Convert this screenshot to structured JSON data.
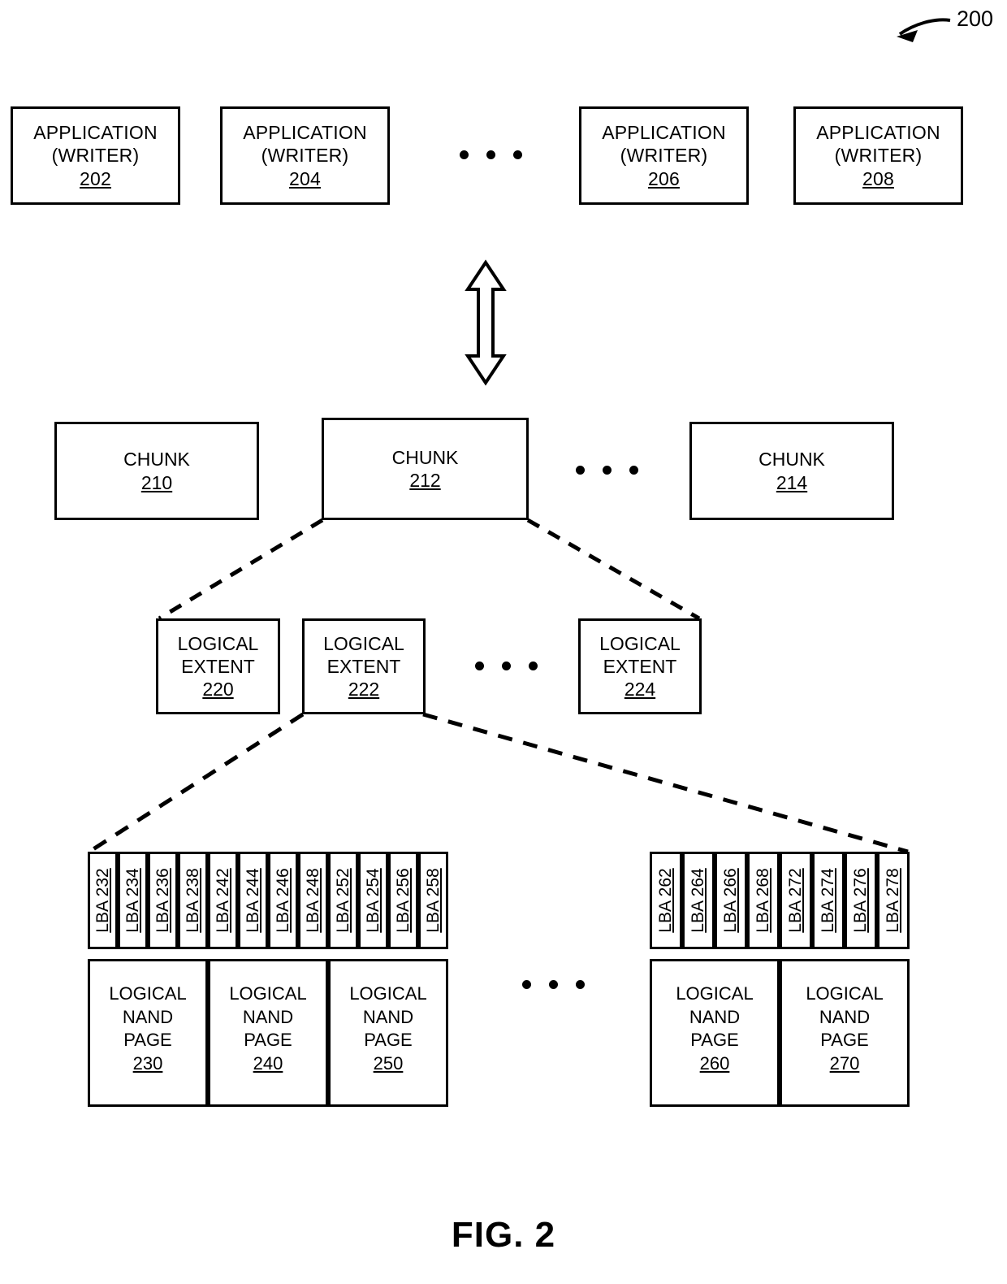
{
  "figure": {
    "caption": "FIG. 2",
    "system_ref": "200"
  },
  "applications": {
    "title": "APPLICATION",
    "subtitle": "(WRITER)",
    "items": [
      {
        "title": "APPLICATION",
        "subtitle": "(WRITER)",
        "ref": "202"
      },
      {
        "title": "APPLICATION",
        "subtitle": "(WRITER)",
        "ref": "204"
      },
      {
        "title": "APPLICATION",
        "subtitle": "(WRITER)",
        "ref": "206"
      },
      {
        "title": "APPLICATION",
        "subtitle": "(WRITER)",
        "ref": "208"
      }
    ]
  },
  "chunks": {
    "label": "CHUNK",
    "items": [
      {
        "label": "CHUNK",
        "ref": "210"
      },
      {
        "label": "CHUNK",
        "ref": "212"
      },
      {
        "label": "CHUNK",
        "ref": "214"
      }
    ]
  },
  "logical_extents": {
    "line1": "LOGICAL",
    "line2": "EXTENT",
    "items": [
      {
        "line1": "LOGICAL",
        "line2": "EXTENT",
        "ref": "220"
      },
      {
        "line1": "LOGICAL",
        "line2": "EXTENT",
        "ref": "222"
      },
      {
        "line1": "LOGICAL",
        "line2": "EXTENT",
        "ref": "224"
      }
    ]
  },
  "nand_pages": {
    "line1": "LOGICAL",
    "line2": "NAND",
    "line3": "PAGE",
    "left_group": [
      {
        "line1": "LOGICAL",
        "line2": "NAND",
        "line3": "PAGE",
        "ref": "230"
      },
      {
        "line1": "LOGICAL",
        "line2": "NAND",
        "line3": "PAGE",
        "ref": "240"
      },
      {
        "line1": "LOGICAL",
        "line2": "NAND",
        "line3": "PAGE",
        "ref": "250"
      }
    ],
    "right_group": [
      {
        "line1": "LOGICAL",
        "line2": "NAND",
        "line3": "PAGE",
        "ref": "260"
      },
      {
        "line1": "LOGICAL",
        "line2": "NAND",
        "line3": "PAGE",
        "ref": "270"
      }
    ]
  },
  "lbas": {
    "prefix": "LBA",
    "left_group": [
      "LBA 232",
      "LBA 234",
      "LBA 236",
      "LBA 238",
      "LBA 242",
      "LBA 244",
      "LBA 246",
      "LBA 248",
      "LBA 252",
      "LBA 254",
      "LBA 256",
      "LBA 258"
    ],
    "right_group": [
      "LBA 262",
      "LBA 264",
      "LBA 266",
      "LBA 268",
      "LBA 272",
      "LBA 274",
      "LBA 276",
      "LBA 278"
    ]
  },
  "colors": {
    "stroke": "#000000",
    "background": "#ffffff"
  },
  "connectors": {
    "bidirectional_arrow": "double-headed-vertical-arrow",
    "chunk_to_extent": "dashed-fan",
    "extent_to_lba": "dashed-fan",
    "callout": "curved-arrow-to-200"
  }
}
